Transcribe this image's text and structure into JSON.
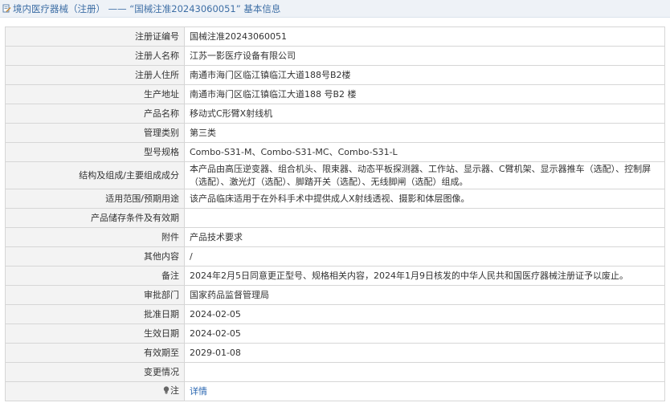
{
  "header": {
    "title": "境内医疗器械（注册） —— “国械注准20243060051” 基本信息",
    "icon": "document-edit-icon"
  },
  "rows": [
    {
      "label": "注册证编号",
      "value": "国械注准20243060051"
    },
    {
      "label": "注册人名称",
      "value": "江苏一影医疗设备有限公司"
    },
    {
      "label": "注册人住所",
      "value": "南通市海门区临江镇临江大道188号B2楼"
    },
    {
      "label": "生产地址",
      "value": "南通市海门区临江镇临江大道188 号B2 楼"
    },
    {
      "label": "产品名称",
      "value": "移动式C形臂X射线机"
    },
    {
      "label": "管理类别",
      "value": "第三类"
    },
    {
      "label": "型号规格",
      "value": "Combo-S31-M、Combo-S31-MC、Combo-S31-L"
    },
    {
      "label": "结构及组成/主要组成成分",
      "value": "本产品由高压逆变器、组合机头、限束器、动态平板探测器、工作站、显示器、C臂机架、显示器推车（选配）、控制屏（选配）、激光灯（选配）、脚踏开关（选配）、无线脚闸（选配）组成。"
    },
    {
      "label": "适用范围/预期用途",
      "value": "该产品临床适用于在外科手术中提供成人X射线透视、摄影和体层图像。"
    },
    {
      "label": "产品储存条件及有效期",
      "value": ""
    },
    {
      "label": "附件",
      "value": "产品技术要求"
    },
    {
      "label": "其他内容",
      "value": "/"
    },
    {
      "label": "备注",
      "value": "2024年2月5日同意更正型号、规格相关内容，2024年1月9日核发的中华人民共和国医疗器械注册证予以废止。"
    },
    {
      "label": "审批部门",
      "value": "国家药品监督管理局"
    },
    {
      "label": "批准日期",
      "value": "2024-02-05"
    },
    {
      "label": "生效日期",
      "value": "2024-02-05"
    },
    {
      "label": "有效期至",
      "value": "2029-01-08"
    },
    {
      "label": "变更情况",
      "value": ""
    }
  ],
  "note_row": {
    "label": "注",
    "icon": "lightbulb-icon",
    "link_text": "详情"
  },
  "colors": {
    "title_text": "#3d6ea5",
    "title_bg": "#eef2f7",
    "label_bg": "#f3f3f3",
    "border": "#d6d6d6",
    "link": "#2a67b1"
  }
}
